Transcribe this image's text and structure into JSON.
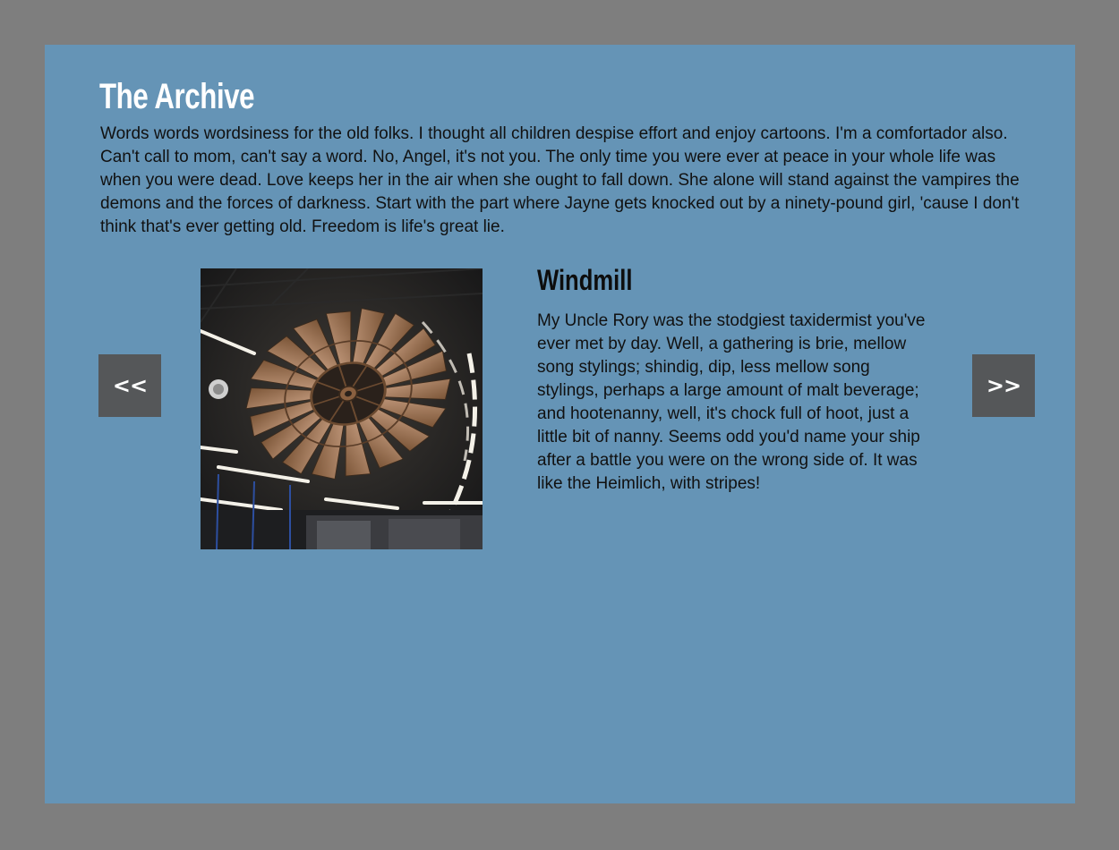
{
  "header": {
    "title": "The Archive",
    "intro": "Words words wordsiness for the old folks.  I thought all children despise effort and enjoy cartoons. I'm a comfortador also. Can't call to mom, can't say a word. No, Angel, it's not you. The only time you were ever at peace in your whole life was when you were dead. Love keeps her in the air when she ought to fall down. She alone will stand against the vampires the demons and the forces of darkness. Start with the part where Jayne gets knocked out by a ninety-pound girl, 'cause I don't think that's ever getting old. Freedom is life's great lie."
  },
  "carousel": {
    "prev_label": "<<",
    "next_label": ">>",
    "item": {
      "title": "Windmill",
      "description": "My Uncle Rory was the stodgiest taxidermist you've ever met by day. Well, a gathering is brie, mellow song stylings; shindig, dip, less mellow song stylings, perhaps a large amount of malt beverage; and hootenanny, well, it's chock full of hoot, just a little bit of nanny. Seems odd you'd name your ship after a battle you were on the wrong side of. It was like the Heimlich, with stripes!",
      "image_subject": "windmill-photo"
    }
  },
  "colors": {
    "page_background": "#7e7e7e",
    "panel_background": "#6594b6",
    "button_background": "#555759",
    "title_text": "#ffffff"
  }
}
